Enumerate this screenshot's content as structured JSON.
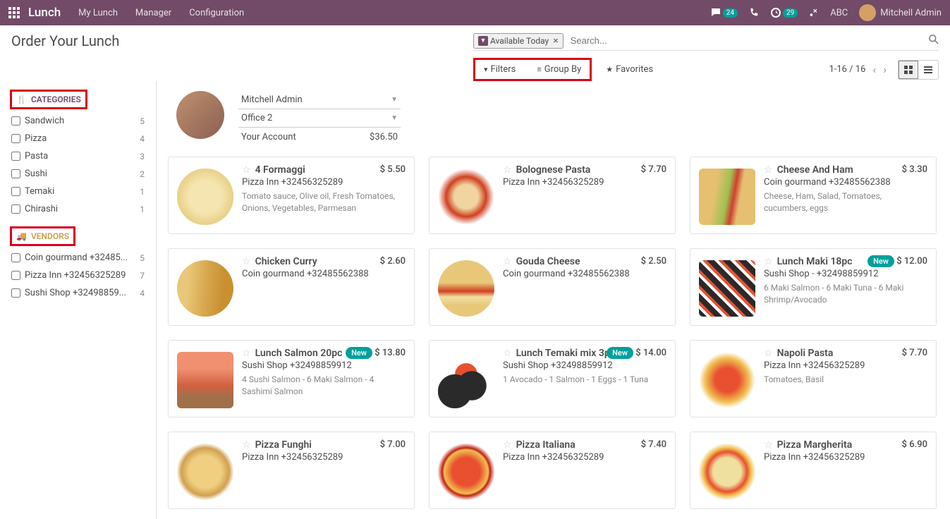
{
  "navbar": {
    "app_title": "Lunch",
    "links": [
      "My Lunch",
      "Manager",
      "Configuration"
    ],
    "badge_chat": "24",
    "badge_clock": "29",
    "company": "ABC",
    "user_name": "Mitchell Admin"
  },
  "header": {
    "title": "Order Your Lunch",
    "facet_label": "Available Today",
    "search_placeholder": "Search...",
    "filters_label": "Filters",
    "groupby_label": "Group By",
    "favorites_label": "Favorites",
    "pager": "1-16 / 16"
  },
  "sidebar": {
    "categories_label": "CATEGORIES",
    "vendors_label": "VENDORS",
    "categories": [
      {
        "label": "Sandwich",
        "count": "5"
      },
      {
        "label": "Pizza",
        "count": "4"
      },
      {
        "label": "Pasta",
        "count": "3"
      },
      {
        "label": "Sushi",
        "count": "2"
      },
      {
        "label": "Temaki",
        "count": "1"
      },
      {
        "label": "Chirashi",
        "count": "1"
      }
    ],
    "vendors": [
      {
        "label": "Coin gourmand +32485...",
        "count": "5"
      },
      {
        "label": "Pizza Inn +32456325289",
        "count": "7"
      },
      {
        "label": "Sushi Shop +32498859...",
        "count": "4"
      }
    ]
  },
  "user": {
    "name": "Mitchell Admin",
    "location": "Office 2",
    "account_label": "Your Account",
    "account_value": "$36.50"
  },
  "products": [
    {
      "title": "4 Formaggi",
      "vendor": "Pizza Inn +32456325289",
      "desc": "Tomato sauce, Olive oil, Fresh Tomatoes, Onions, Vegetables, Parmesan",
      "price": "$ 5.50",
      "new": false,
      "img": "food1"
    },
    {
      "title": "Bolognese Pasta",
      "vendor": "Pizza Inn +32456325289",
      "desc": "",
      "price": "$ 7.70",
      "new": false,
      "img": "food2"
    },
    {
      "title": "Cheese And Ham",
      "vendor": "Coin gourmand +32485562388",
      "desc": "Cheese, Ham, Salad, Tomatoes, cucumbers, eggs",
      "price": "$ 3.30",
      "new": false,
      "img": "food3"
    },
    {
      "title": "Chicken Curry",
      "vendor": "Coin gourmand +32485562388",
      "desc": "",
      "price": "$ 2.60",
      "new": false,
      "img": "food4"
    },
    {
      "title": "Gouda Cheese",
      "vendor": "Coin gourmand +32485562388",
      "desc": "",
      "price": "$ 2.50",
      "new": false,
      "img": "food5"
    },
    {
      "title": "Lunch Maki 18pc",
      "vendor": "Sushi Shop - +32498859912",
      "desc": "6 Maki Salmon - 6 Maki Tuna - 6 Maki Shrimp/Avocado",
      "price": "$ 12.00",
      "new": true,
      "img": "food6"
    },
    {
      "title": "Lunch Salmon 20pc",
      "vendor": "Sushi Shop +32498859912",
      "desc": "4 Sushi Salmon - 6 Maki Salmon - 4 Sashimi Salmon",
      "price": "$ 13.80",
      "new": true,
      "img": "food7"
    },
    {
      "title": "Lunch Temaki mix 3pc",
      "vendor": "Sushi Shop +32498859912",
      "desc": "1 Avocado - 1 Salmon - 1 Eggs - 1 Tuna",
      "price": "$ 14.00",
      "new": true,
      "img": "food8"
    },
    {
      "title": "Napoli Pasta",
      "vendor": "Pizza Inn +32456325289",
      "desc": "Tomatoes, Basil",
      "price": "$ 7.70",
      "new": false,
      "img": "food9"
    },
    {
      "title": "Pizza Funghi",
      "vendor": "Pizza Inn +32456325289",
      "desc": "",
      "price": "$ 7.00",
      "new": false,
      "img": "food10"
    },
    {
      "title": "Pizza Italiana",
      "vendor": "Pizza Inn +32456325289",
      "desc": "",
      "price": "$ 7.40",
      "new": false,
      "img": "food11"
    },
    {
      "title": "Pizza Margherita",
      "vendor": "Pizza Inn +32456325289",
      "desc": "",
      "price": "$ 6.90",
      "new": false,
      "img": "food12"
    }
  ],
  "new_label": "New"
}
